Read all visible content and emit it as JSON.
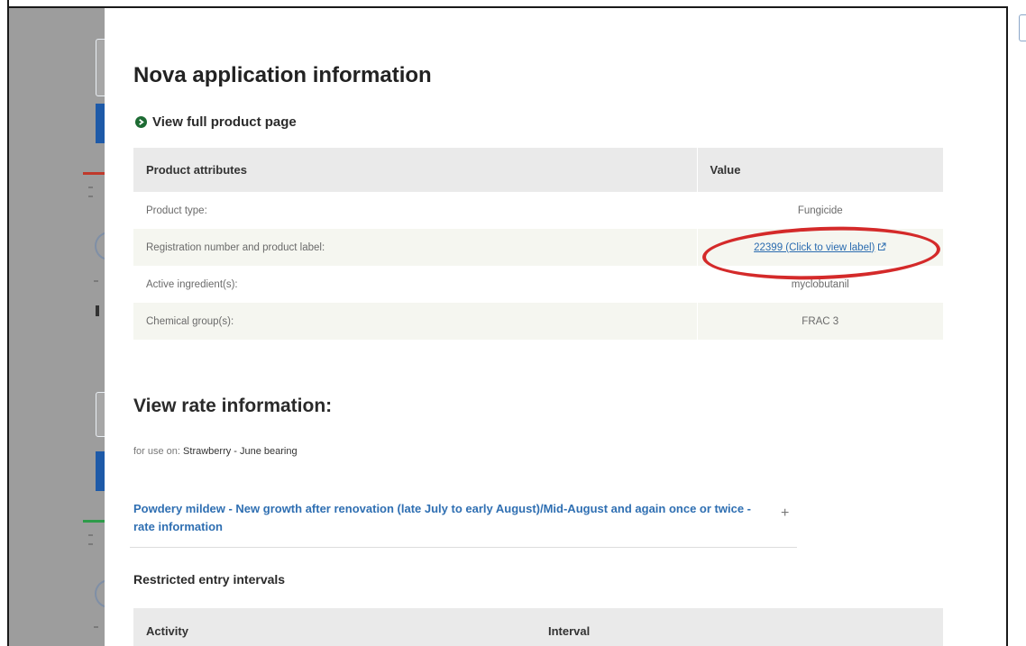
{
  "page": {
    "title": "Nova application information",
    "product_link": "View full product page"
  },
  "attributes_table": {
    "headers": [
      "Product attributes",
      "Value"
    ],
    "rows": [
      {
        "attribute": "Product type:",
        "value": "Fungicide"
      },
      {
        "attribute": "Registration number and product label:",
        "value": "22399 (Click to view label)"
      },
      {
        "attribute": "Active ingredient(s):",
        "value": "myclobutanil"
      },
      {
        "attribute": "Chemical group(s):",
        "value": "FRAC 3"
      }
    ]
  },
  "rate_section": {
    "title": "View rate information:",
    "for_use_prefix": "for use on:",
    "crop": "Strawberry - June bearing",
    "accordion": {
      "title": "Powdery mildew - New growth after renovation (late July to early August)/Mid-August and again once or twice - rate information",
      "expand_symbol": "+"
    }
  },
  "restricted_entry": {
    "title": "Restricted entry intervals",
    "headers": [
      "Activity",
      "Interval"
    ]
  },
  "colors": {
    "link_blue": "#2b6cb0",
    "annotation_red": "#d42a2a",
    "arrow_green": "#1d6b33",
    "overlay_gray": "#9d9d9d"
  },
  "icons": [
    "arrow-right-circle-icon",
    "external-link-icon",
    "plus-icon"
  ]
}
